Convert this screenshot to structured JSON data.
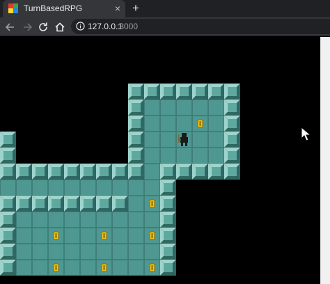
{
  "browser": {
    "tab_title": "TurnBasedRPG",
    "tab_close_glyph": "×",
    "new_tab_glyph": "+",
    "url_host": "127.0.0.1",
    "url_port": ":3000",
    "icons": [
      "back-arrow-icon",
      "forward-arrow-icon",
      "reload-icon",
      "home-icon",
      "site-info-icon",
      "close-icon",
      "plus-icon"
    ]
  },
  "game": {
    "tiles": {
      "wall": [
        [
          9,
          3
        ],
        [
          10,
          3
        ],
        [
          11,
          3
        ],
        [
          12,
          3
        ],
        [
          13,
          3
        ],
        [
          14,
          3
        ],
        [
          15,
          3
        ],
        [
          9,
          4
        ],
        [
          15,
          4
        ],
        [
          9,
          5
        ],
        [
          15,
          5
        ],
        [
          9,
          6
        ],
        [
          15,
          6
        ],
        [
          9,
          7
        ],
        [
          15,
          7
        ],
        [
          0,
          6
        ],
        [
          1,
          6
        ],
        [
          0,
          7
        ],
        [
          1,
          7
        ],
        [
          1,
          8
        ],
        [
          2,
          8
        ],
        [
          3,
          8
        ],
        [
          4,
          8
        ],
        [
          5,
          8
        ],
        [
          6,
          8
        ],
        [
          7,
          8
        ],
        [
          8,
          8
        ],
        [
          9,
          8
        ],
        [
          11,
          8
        ],
        [
          12,
          8
        ],
        [
          13,
          8
        ],
        [
          14,
          8
        ],
        [
          15,
          8
        ],
        [
          11,
          9
        ],
        [
          1,
          10
        ],
        [
          2,
          10
        ],
        [
          3,
          10
        ],
        [
          4,
          10
        ],
        [
          5,
          10
        ],
        [
          6,
          10
        ],
        [
          7,
          10
        ],
        [
          8,
          10
        ],
        [
          11,
          10
        ],
        [
          1,
          11
        ],
        [
          11,
          11
        ],
        [
          1,
          12
        ],
        [
          11,
          12
        ],
        [
          1,
          13
        ],
        [
          11,
          13
        ],
        [
          1,
          14
        ],
        [
          11,
          14
        ]
      ],
      "floor": [
        [
          10,
          4
        ],
        [
          11,
          4
        ],
        [
          12,
          4
        ],
        [
          13,
          4
        ],
        [
          14,
          4
        ],
        [
          10,
          5
        ],
        [
          11,
          5
        ],
        [
          12,
          5
        ],
        [
          13,
          5
        ],
        [
          14,
          5
        ],
        [
          10,
          6
        ],
        [
          11,
          6
        ],
        [
          12,
          6
        ],
        [
          13,
          6
        ],
        [
          14,
          6
        ],
        [
          10,
          7
        ],
        [
          11,
          7
        ],
        [
          12,
          7
        ],
        [
          13,
          7
        ],
        [
          14,
          7
        ],
        [
          0,
          8
        ],
        [
          10,
          8
        ],
        [
          0,
          9
        ],
        [
          1,
          9
        ],
        [
          2,
          9
        ],
        [
          3,
          9
        ],
        [
          4,
          9
        ],
        [
          5,
          9
        ],
        [
          6,
          9
        ],
        [
          7,
          9
        ],
        [
          8,
          9
        ],
        [
          9,
          9
        ],
        [
          10,
          9
        ],
        [
          0,
          10
        ],
        [
          9,
          10
        ],
        [
          10,
          10
        ],
        [
          0,
          11
        ],
        [
          2,
          11
        ],
        [
          3,
          11
        ],
        [
          4,
          11
        ],
        [
          5,
          11
        ],
        [
          6,
          11
        ],
        [
          7,
          11
        ],
        [
          8,
          11
        ],
        [
          9,
          11
        ],
        [
          10,
          11
        ],
        [
          0,
          12
        ],
        [
          2,
          12
        ],
        [
          3,
          12
        ],
        [
          4,
          12
        ],
        [
          5,
          12
        ],
        [
          6,
          12
        ],
        [
          7,
          12
        ],
        [
          8,
          12
        ],
        [
          9,
          12
        ],
        [
          10,
          12
        ],
        [
          0,
          13
        ],
        [
          2,
          13
        ],
        [
          3,
          13
        ],
        [
          4,
          13
        ],
        [
          5,
          13
        ],
        [
          6,
          13
        ],
        [
          7,
          13
        ],
        [
          8,
          13
        ],
        [
          9,
          13
        ],
        [
          10,
          13
        ],
        [
          2,
          14
        ],
        [
          3,
          14
        ],
        [
          4,
          14
        ],
        [
          5,
          14
        ],
        [
          6,
          14
        ],
        [
          7,
          14
        ],
        [
          8,
          14
        ],
        [
          9,
          14
        ],
        [
          10,
          14
        ]
      ]
    },
    "coins": [
      [
        13,
        5
      ],
      [
        10,
        10
      ],
      [
        4,
        12
      ],
      [
        7,
        12
      ],
      [
        10,
        12
      ],
      [
        4,
        14
      ],
      [
        7,
        14
      ],
      [
        10,
        14
      ]
    ],
    "player": [
      12,
      6
    ],
    "colors": {
      "floor": "#4f9892",
      "floor_grid": "#3f7e78",
      "wall_light": "#9fd4cc",
      "wall_face": "#5ea8a0",
      "wall_shadow": "#2f6863",
      "coin": "#f2c41c",
      "coin_edge": "#8a6a08",
      "player": "#1b1b1b",
      "player_accent": "#3a6b3a"
    }
  }
}
